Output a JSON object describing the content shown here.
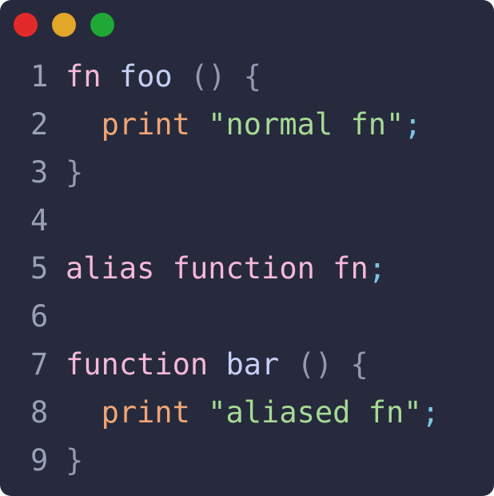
{
  "colors": {
    "background": "#262a3c",
    "close": "#e22a2a",
    "minimize": "#e2a629",
    "maximize": "#1fa835",
    "line_number": "#9aa0b8",
    "keyword": "#f5b8d8",
    "identifier": "#c6d0f5",
    "punctuation": "#9399b2",
    "builtin": "#f0a478",
    "string": "#a6da95",
    "semicolon": "#7dc4e4"
  },
  "window_controls": [
    {
      "name": "close",
      "icon": "close-dot-icon"
    },
    {
      "name": "minimize",
      "icon": "minimize-dot-icon"
    },
    {
      "name": "maximize",
      "icon": "maximize-dot-icon"
    }
  ],
  "code": {
    "lines": [
      {
        "number": "1",
        "tokens": [
          {
            "text": "fn",
            "kind": "keyword"
          },
          {
            "text": " ",
            "kind": "space"
          },
          {
            "text": "foo",
            "kind": "identifier"
          },
          {
            "text": " ",
            "kind": "space"
          },
          {
            "text": "()",
            "kind": "punctuation"
          },
          {
            "text": " ",
            "kind": "space"
          },
          {
            "text": "{",
            "kind": "punctuation"
          }
        ]
      },
      {
        "number": "2",
        "tokens": [
          {
            "text": "  ",
            "kind": "space"
          },
          {
            "text": "print",
            "kind": "builtin"
          },
          {
            "text": " ",
            "kind": "space"
          },
          {
            "text": "\"normal fn\"",
            "kind": "string"
          },
          {
            "text": ";",
            "kind": "semicolon"
          }
        ]
      },
      {
        "number": "3",
        "tokens": [
          {
            "text": "}",
            "kind": "punctuation"
          }
        ]
      },
      {
        "number": "4",
        "tokens": []
      },
      {
        "number": "5",
        "tokens": [
          {
            "text": "alias",
            "kind": "keyword"
          },
          {
            "text": " ",
            "kind": "space"
          },
          {
            "text": "function",
            "kind": "keyword"
          },
          {
            "text": " ",
            "kind": "space"
          },
          {
            "text": "fn",
            "kind": "keyword"
          },
          {
            "text": ";",
            "kind": "semicolon"
          }
        ]
      },
      {
        "number": "6",
        "tokens": []
      },
      {
        "number": "7",
        "tokens": [
          {
            "text": "function",
            "kind": "keyword"
          },
          {
            "text": " ",
            "kind": "space"
          },
          {
            "text": "bar",
            "kind": "identifier"
          },
          {
            "text": " ",
            "kind": "space"
          },
          {
            "text": "()",
            "kind": "punctuation"
          },
          {
            "text": " ",
            "kind": "space"
          },
          {
            "text": "{",
            "kind": "punctuation"
          }
        ]
      },
      {
        "number": "8",
        "tokens": [
          {
            "text": "  ",
            "kind": "space"
          },
          {
            "text": "print",
            "kind": "builtin"
          },
          {
            "text": " ",
            "kind": "space"
          },
          {
            "text": "\"aliased fn\"",
            "kind": "string"
          },
          {
            "text": ";",
            "kind": "semicolon"
          }
        ]
      },
      {
        "number": "9",
        "tokens": [
          {
            "text": "}",
            "kind": "punctuation"
          }
        ]
      }
    ]
  }
}
